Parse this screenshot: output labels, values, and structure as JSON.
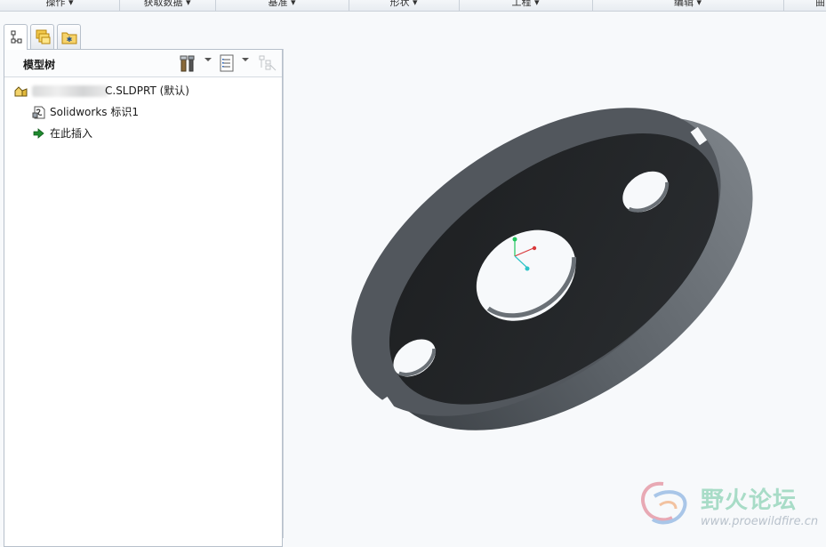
{
  "ribbon": {
    "groups": [
      "操作",
      "获取数据",
      "基准",
      "形状",
      "工程",
      "编辑",
      "曲"
    ]
  },
  "navigator": {
    "tabs": [
      "model-tree-tab",
      "folder-browser-tab",
      "favorites-tab"
    ]
  },
  "model_tree": {
    "title": "模型树",
    "items": [
      {
        "label": "C.SLDPRT (默认)",
        "icon": "part-icon"
      },
      {
        "label": "Solidworks 标识1",
        "icon": "import-feature-icon"
      },
      {
        "label": "在此插入",
        "icon": "insert-here-arrow-icon"
      }
    ]
  },
  "watermark": {
    "title": "野火论坛",
    "url": "www.proewildfire.cn"
  },
  "colors": {
    "panel_border": "#b7c0cb",
    "model_dark": "#222426",
    "model_rim": "#4b5056",
    "background": "#f7f9fb"
  }
}
